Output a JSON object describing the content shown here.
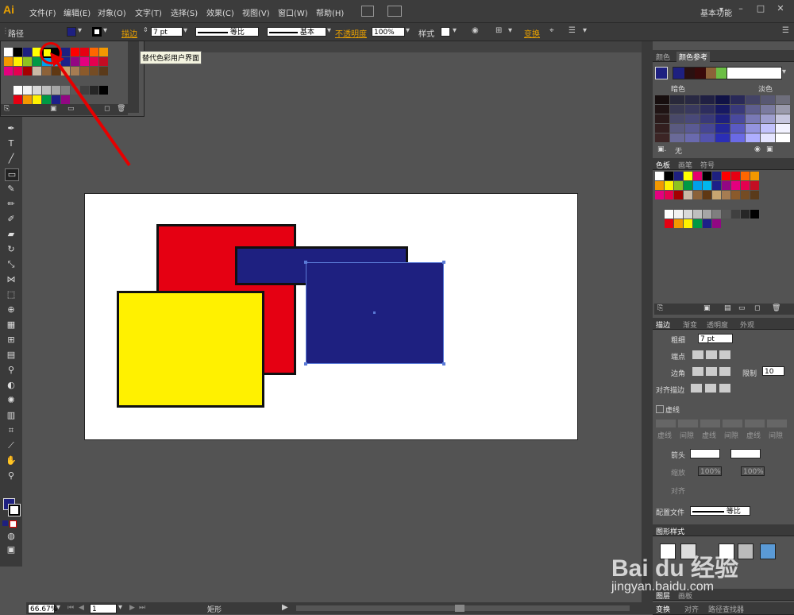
{
  "app": {
    "logo": "Ai"
  },
  "menu": [
    "文件(F)",
    "编辑(E)",
    "对象(O)",
    "文字(T)",
    "选择(S)",
    "效果(C)",
    "视图(V)",
    "窗口(W)",
    "帮助(H)"
  ],
  "workspace": "基本功能",
  "window_controls": [
    "–",
    "□",
    "✕"
  ],
  "control_bar": {
    "object_type": "路径",
    "stroke_label": "描边",
    "stroke_weight": "7 pt",
    "profile_label": "等比",
    "brush_label": "基本",
    "opacity_label": "不透明度",
    "opacity_value": "100%",
    "style_label": "样式",
    "transform_label": "变换"
  },
  "tooltip": "替代色彩用户界面",
  "colors": {
    "accent_orange": "#e8a000",
    "fill_current": "#1e2080",
    "red_rect": "#e50012",
    "yellow_rect": "#fff100",
    "blue_rect": "#1e2080",
    "annotation_red": "#e60000"
  },
  "swatches_popup": {
    "row1": [
      "#ffffff",
      "#000000",
      "#1e2080",
      "#ffff00",
      "#e6006e",
      "#000000",
      "#1e2080",
      "#ff0000",
      "#e60012",
      "#ff6600",
      "#f39800"
    ],
    "row2": [
      "#f39800",
      "#fff100",
      "#8fc31f",
      "#009944",
      "#00a0e9",
      "#00b7ee",
      "#1d2088",
      "#920783",
      "#e4007f",
      "#e5004f",
      "#c30d23"
    ],
    "row3": [
      "#e4007f",
      "#e5004f",
      "#a40000",
      "#c9b9a6",
      "#8c6239",
      "#603813",
      "#c7a570",
      "#a67c52",
      "#8b5a2b",
      "#754c24",
      "#5a3a1a"
    ],
    "row5": [
      "#ffffff",
      "#f2f2f2",
      "#d9d9d9",
      "#bfbfbf",
      "#a6a6a6",
      "#7f7f7f",
      "#595959",
      "#404040",
      "#262626",
      "#000000"
    ],
    "row6": [
      "#e60012",
      "#f39800",
      "#fff100",
      "#009944",
      "#1d2088",
      "#920783"
    ]
  },
  "panel_color_guide": {
    "tabs": [
      "颜色",
      "颜色参考"
    ],
    "dark_label": "暗色",
    "light_label": "淡色",
    "none_label": "无",
    "harmony": [
      "#1e2080",
      "#2a1010",
      "#3a0a0a",
      "#8c6239",
      "#6cbe45"
    ],
    "grid_cols": [
      "#2a1a1a",
      "#4a4a6a",
      "#4a4a7a",
      "#3a3a7a",
      "#1e2080",
      "#4a4aa0",
      "#7a7ab8",
      "#a0a0d0",
      "#c8c8e0"
    ]
  },
  "panel_swatches": {
    "tabs": [
      "色板",
      "画笔",
      "符号"
    ]
  },
  "panel_stroke": {
    "tabs": [
      "描边",
      "渐变",
      "透明度",
      "外观"
    ],
    "weight_label": "粗细",
    "weight_value": "7 pt",
    "cap_label": "端点",
    "corner_label": "边角",
    "limit_label": "限制",
    "limit_value": "10",
    "align_label": "对齐描边",
    "dashed_label": "虚线",
    "dash_labels": [
      "虚线",
      "间隙",
      "虚线",
      "间隙",
      "虚线",
      "间隙"
    ],
    "arrow_label": "箭头",
    "scale_label": "缩放",
    "scale1": "100%",
    "scale2": "100%",
    "align2_label": "对齐",
    "profile_label": "配置文件",
    "profile_value": "等比"
  },
  "panel_graphic_styles": {
    "tabs": [
      "图形样式"
    ]
  },
  "panel_layers": {
    "tabs": [
      "图层",
      "画板"
    ]
  },
  "panel_bottom": {
    "tabs": [
      "变换",
      "对齐",
      "路径查找器"
    ]
  },
  "status": {
    "zoom": "66.67%",
    "artboard_num": "1",
    "tool_name": "矩形"
  },
  "watermark": {
    "brand": "Bai du 经验",
    "url": "jingyan.baidu.com"
  }
}
